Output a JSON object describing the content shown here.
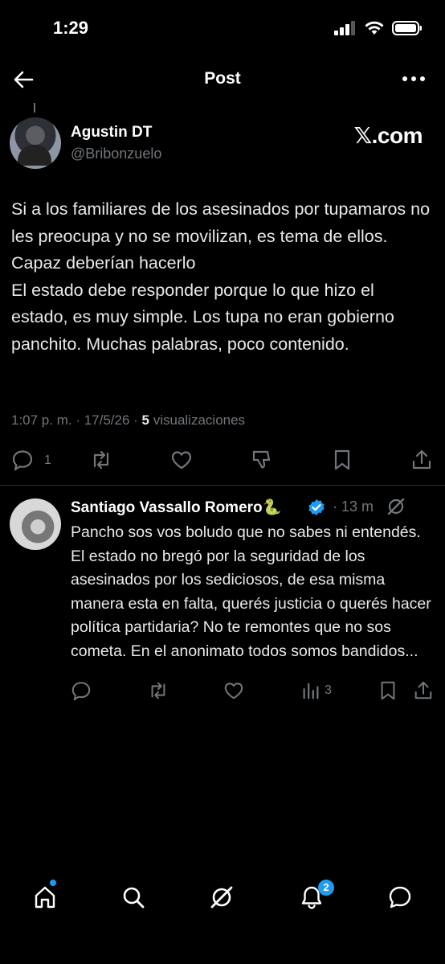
{
  "status_bar": {
    "time": "1:29"
  },
  "header": {
    "title": "Post"
  },
  "post": {
    "author_name": "Agustin DT",
    "author_handle": "@Bribonzuelo",
    "source_label": "𝕏.com",
    "text": "Si a los familiares de los asesinados por tupamaros no les preocupa y no se movilizan, es tema de ellos. Capaz deberían hacerlo\nEl estado debe responder porque lo que hizo el estado, es muy simple. Los tupa no eran gobierno panchito. Muchas palabras, poco contenido.",
    "meta_prefix": "1:07 p. m. · 17/5/26 · ",
    "views_count": "5",
    "views_label": " visualizaciones",
    "reply_count": "1"
  },
  "reply": {
    "author_name": "Santiago Vassallo Romero🐍",
    "time": "· 13 m",
    "text": "Pancho sos vos boludo que no sabes ni entendés. El estado no bregó por la seguridad de los asesinados por los sediciosos, de esa misma manera esta en falta, querés justicia o querés hacer política partidaria? No te remontes que no sos cometa. En el anonimato todos somos bandidos...",
    "views_count": "3"
  },
  "nav": {
    "notifications_badge": "2"
  },
  "colors": {
    "accent": "#1d9bf0",
    "background": "#000000",
    "muted": "#71767b",
    "text": "#e7e9ea"
  }
}
